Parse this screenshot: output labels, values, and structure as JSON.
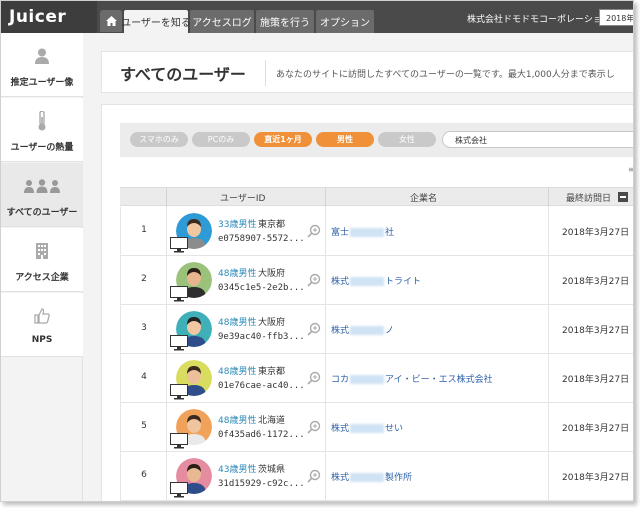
{
  "app": {
    "logo": "Juicer",
    "company": "株式会社ドモドモコーポレーション",
    "date_fragment": "2018年"
  },
  "nav": {
    "tabs": [
      {
        "label": "ユーザーを知る",
        "active": true
      },
      {
        "label": "アクセスログ",
        "active": false
      },
      {
        "label": "施策を行う",
        "active": false
      },
      {
        "label": "オプション",
        "active": false
      }
    ]
  },
  "sidebar": {
    "items": [
      {
        "label": "推定ユーザー像",
        "icon": "person-icon",
        "active": false
      },
      {
        "label": "ユーザーの熱量",
        "icon": "thermometer-icon",
        "active": false
      },
      {
        "label": "すべてのユーザー",
        "icon": "group-icon",
        "active": true
      },
      {
        "label": "アクセス企業",
        "icon": "building-icon",
        "active": false
      },
      {
        "label": "NPS",
        "icon": "thumbs-up-icon",
        "active": false
      }
    ]
  },
  "page": {
    "title": "すべてのユーザー",
    "description": "あなたのサイトに訪問したすべてのユーザーの一覧です。最大1,000人分まで表示し"
  },
  "filters": {
    "chips": [
      {
        "label": "スマホのみ",
        "active": false
      },
      {
        "label": "PCのみ",
        "active": false
      },
      {
        "label": "直近1ヶ月",
        "active": true
      },
      {
        "label": "男性",
        "active": true
      },
      {
        "label": "女性",
        "active": false
      }
    ],
    "company_query": "株式会社"
  },
  "table": {
    "columns": {
      "user_id": "ユーザーID",
      "company": "企業名",
      "last_visit": "最終訪問日"
    },
    "rows": [
      {
        "num": "1",
        "age": "33歳男性",
        "loc": "東京都",
        "id": "e0758907-5572...",
        "co_pre": "富士",
        "co_post": "社",
        "date": "2018年3月27日"
      },
      {
        "num": "2",
        "age": "48歳男性",
        "loc": "大阪府",
        "id": "0345c1e5-2e2b...",
        "co_pre": "株式",
        "co_post": "トライト",
        "date": "2018年3月27日"
      },
      {
        "num": "3",
        "age": "48歳男性",
        "loc": "大阪府",
        "id": "9e39ac40-ffb3...",
        "co_pre": "株式",
        "co_post": "ノ",
        "date": "2018年3月27日"
      },
      {
        "num": "4",
        "age": "48歳男性",
        "loc": "東京都",
        "id": "01e76cae-ac40...",
        "co_pre": "コカ",
        "co_post": "アイ・ビー・エス株式会社",
        "date": "2018年3月27日"
      },
      {
        "num": "5",
        "age": "48歳男性",
        "loc": "北海道",
        "id": "0f435ad6-1172...",
        "co_pre": "株式",
        "co_post": "せい",
        "date": "2018年3月27日"
      },
      {
        "num": "6",
        "age": "43歳男性",
        "loc": "茨城県",
        "id": "31d15929-c92c...",
        "co_pre": "株式",
        "co_post": "製作所",
        "date": "2018年3月27日"
      }
    ]
  },
  "colors": {
    "topbar": "#4a4a4a",
    "accent_orange": "#f0913a",
    "link_blue": "#2b8ab8"
  }
}
